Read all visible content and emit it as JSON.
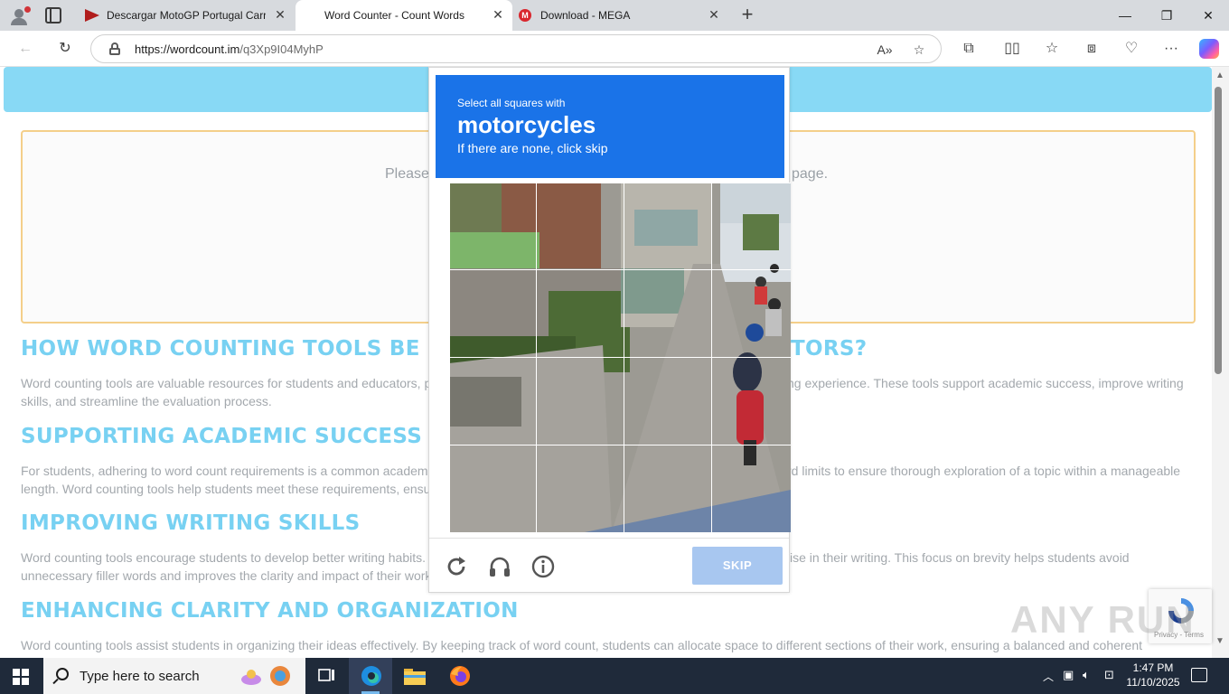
{
  "browser": {
    "tabs": [
      {
        "title": "Descargar MotoGP Portugal Carre",
        "favicon": "motogp-favicon",
        "active": false
      },
      {
        "title": "Word Counter - Count Words",
        "favicon": "none",
        "active": true
      },
      {
        "title": "Download - MEGA",
        "favicon": "mega-favicon",
        "active": false
      }
    ],
    "address": {
      "url_host": "https://wordcount.im",
      "url_path": "/q3Xp9I04MyhP"
    },
    "window_controls": {
      "minimize": "—",
      "restore": "❐",
      "close": "✕"
    }
  },
  "page": {
    "ad_text_left": "Please",
    "ad_text_right": "page.",
    "sections": [
      {
        "heading_left": "HOW WORD COUNTING TOOLS BE",
        "heading_right": "TORS?",
        "line1_left": "Word counting tools are valuable resources for students and educators, p",
        "line1_right": "ng experience. These tools support academic success, improve writing",
        "line2_left": "skills, and streamline the evaluation process.",
        "line2_right": ""
      },
      {
        "heading_left": "SUPPORTING ACADEMIC SUCCESS",
        "heading_right": "",
        "line1_left": "For students, adhering to word count requirements is a common academ",
        "line1_right": "rd limits to ensure thorough exploration of a topic within a manageable",
        "line2_left": "length. Word counting tools help students meet these requirements, ensu",
        "line2_right": ""
      },
      {
        "heading_left": "IMPROVING WRITING SKILLS",
        "heading_right": "",
        "line1_left": "Word counting tools encourage students to develop better writing habits.",
        "line1_right": "ise in their writing. This focus on brevity helps students avoid",
        "line2_left": "unnecessary filler words and improves the clarity and impact of their work",
        "line2_right": ""
      },
      {
        "heading_left": "ENHANCING CLARITY AND ORGANIZATION",
        "heading_right": "",
        "line1_left": "Word counting tools assist students in organizing their ideas effectively. By keeping track of word count, students can allocate space to different sections of their work, ensuring a balanced and coherent",
        "line1_right": "",
        "line2_left": "",
        "line2_right": ""
      }
    ]
  },
  "captcha": {
    "instruction_small": "Select all squares with",
    "target": "motorcycles",
    "hint": "If there are none, click skip",
    "skip_label": "SKIP",
    "grid_rows": 4,
    "grid_cols": 4,
    "header_color": "#1a73e8",
    "skip_color": "#a8c7f0"
  },
  "recaptcha_badge": {
    "terms": "Privacy - Terms"
  },
  "watermark": "ANY RUN",
  "taskbar": {
    "search_placeholder": "Type here to search",
    "time": "1:47 PM",
    "date": "11/10/2025"
  }
}
